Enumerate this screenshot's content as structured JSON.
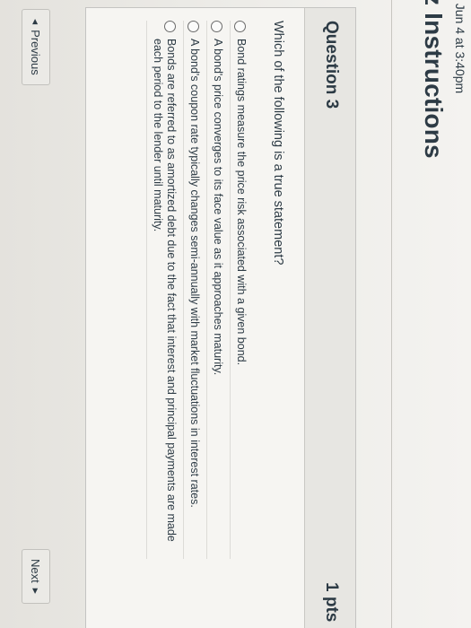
{
  "quiz": {
    "due_fragment": ": Jun 4 at 3:40pm",
    "heading": "z Instructions"
  },
  "question": {
    "title": "Question 3",
    "points": "1 pts",
    "text": "Which of the following is a true statement?",
    "answers": [
      {
        "label": "Bond ratings measure the price risk associated with a given bond."
      },
      {
        "label": "A bond's price converges to its face value as it approaches maturity."
      },
      {
        "label": "A bond's coupon rate typically changes semi-annually with market fluctuations in interest rates."
      },
      {
        "label": "Bonds are referred to as amortized debt due to the fact that interest and principal payments are made each period to the lender until maturity."
      }
    ]
  },
  "navigation": {
    "previous_label": "Previous",
    "next_label": "Next",
    "previous_icon": "triangle-left-icon",
    "next_icon": "triangle-right-icon"
  }
}
